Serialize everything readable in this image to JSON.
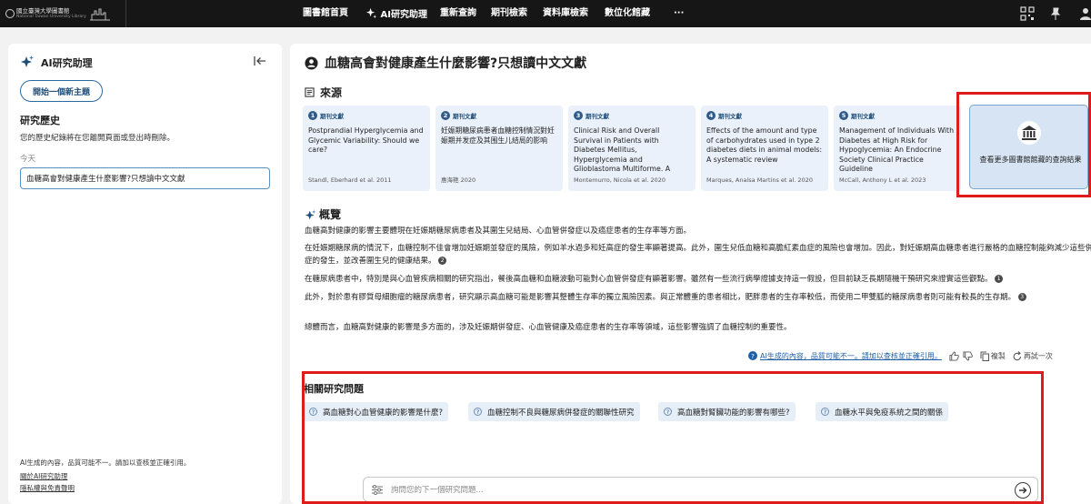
{
  "header": {
    "logo_zh": "國立臺灣大學圖書館",
    "logo_en": "National Taiwan University Library",
    "nav": [
      "圖書館首頁",
      "AI研究助理",
      "重新查詢",
      "期刊檢索",
      "資料庫檢索",
      "數位化館藏",
      "···"
    ],
    "icons": [
      "qr-code-icon",
      "pin-icon",
      "user-icon"
    ]
  },
  "sidebar": {
    "title": "AI研究助理",
    "new_topic": "開始一個新主題",
    "history_title": "研究歷史",
    "history_note": "您的歷史紀錄將在您離開頁面或登出時刪除。",
    "today": "今天",
    "history_items": [
      "血糖高會對健康產生什麼影響?只想讀中文文獻"
    ],
    "disclaimer": "AI生成的內容，品質可能不一。請加以查核並正確引用。",
    "about_link": "關於AI研究助理",
    "privacy_link": "隱私權與免責聲明"
  },
  "main": {
    "query_title": "血糖高會對健康產生什麼影響?只想讀中文文獻",
    "sources_title": "來源",
    "sources": [
      {
        "num": "1",
        "type": "期刊文獻",
        "title": "Postprandial Hyperglycemia and Glycemic Variability: Should we care?",
        "author": "Standl, Eberhard et al. 2011"
      },
      {
        "num": "2",
        "type": "期刊文獻",
        "title": "妊娠期糖尿病患者血糖控制情況對妊娠期并发症及其围生儿结局的影响",
        "author": "惠海艳 2020"
      },
      {
        "num": "3",
        "type": "期刊文獻",
        "title": "Clinical Risk and Overall Survival in Patients with Diabetes Mellitus, Hyperglycemia and Glioblastoma Multiforme. A Review of the Current Literature",
        "author": "Montemurro, Nicola et al. 2020"
      },
      {
        "num": "4",
        "type": "期刊文獻",
        "title": "Effects of the amount and type of carbohydrates used in type 2 diabetes diets in animal models: A systematic review",
        "author": "Marques, Anaísa Martins et al. 2020"
      },
      {
        "num": "5",
        "type": "期刊文獻",
        "title": "Management of Individuals With Diabetes at High Risk for Hypoglycemia: An Endocrine Society Clinical Practice Guideline",
        "author": "McCall, Anthony L et al. 2023"
      }
    ],
    "more_results": "查看更多圖書館館藏的查詢結果",
    "summary_title": "概覽",
    "paragraphs": {
      "p1": "血糖高對健康的影響主要體現在妊娠期糖尿病患者及其圍生兒結局、心血管併發症以及癌症患者的生存率等方面。",
      "p2": "在妊娠期糖尿病的情況下，血糖控制不佳會增加妊娠期並發症的風險，例如羊水過多和妊高症的發生率顯著提高。此外，圍生兒低血糖和高膽紅素血症的風險也會增加。因此，對妊娠期高血糖患者進行嚴格的血糖控制能夠減少這些併發症的發生，並改善圍生兒的健康結果。",
      "p2_cite": "2",
      "p3": "在糖尿病患者中，特別是與心血管疾病相關的研究指出，餐後高血糖和血糖波動可能對心血管併發症有顯著影響。雖然有一些流行病學證據支持這一假設，但目前缺乏長期隨機干預研究來證實這些觀點。",
      "p3_cite": "1",
      "p4": "此外，對於患有膠質母細胞瘤的糖尿病患者，研究顯示高血糖可能是影響其整體生存率的獨立風險因素。與正常體重的患者相比，肥胖患者的生存率較低，而使用二甲雙胍的糖尿病患者則可能有較長的生存期。",
      "p4_cite": "3",
      "p5": "總體而言，血糖高對健康的影響是多方面的，涉及妊娠期併發症、心血管健康及癌症患者的生存率等領域，這些影響強調了血糖控制的重要性。"
    },
    "ai_disclaimer": "AI生成的內容，品質可能不一。請加以查核並正確引用。",
    "copy_label": "複製",
    "retry_label": "再試一次",
    "related_title": "相關研究問題",
    "related_questions": [
      "高血糖對心血管健康的影響是什麼?",
      "血糖控制不良與糖尿病併發症的關聯性研究",
      "高血糖對腎臟功能的影響有哪些?",
      "血糖水平與免疫系統之間的關係"
    ],
    "ask_placeholder": "詢問您的下一個研究問題..."
  },
  "colors": {
    "highlight": "#e01b1b",
    "topbar": "#161616",
    "card_bg": "#eaf1fa",
    "accent": "#2b6a9f"
  }
}
